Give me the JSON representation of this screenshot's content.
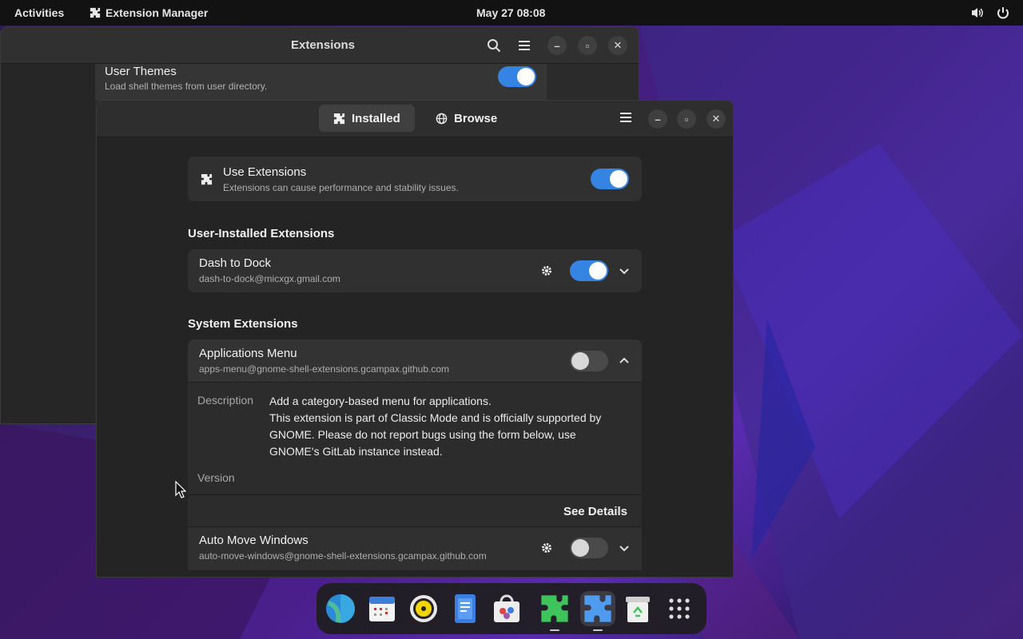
{
  "topbar": {
    "activities": "Activities",
    "app_menu": "Extension Manager",
    "clock": "May 27  08:08"
  },
  "back_window": {
    "title": "Extensions",
    "row": {
      "title": "User Themes",
      "subtitle": "Load shell themes from user directory.",
      "enabled": true
    }
  },
  "front_window": {
    "tabs": [
      {
        "label": "Installed",
        "icon": "puzzle-icon",
        "active": true
      },
      {
        "label": "Browse",
        "icon": "globe-icon",
        "active": false
      }
    ],
    "use_extensions": {
      "title": "Use Extensions",
      "subtitle": "Extensions can cause performance and stability issues.",
      "enabled": true
    },
    "user_section_title": "User-Installed Extensions",
    "user_extensions": [
      {
        "title": "Dash to Dock",
        "uuid": "dash-to-dock@micxgx.gmail.com",
        "enabled": true,
        "has_settings": true
      }
    ],
    "system_section_title": "System Extensions",
    "system_extensions": [
      {
        "title": "Applications Menu",
        "uuid": "apps-menu@gnome-shell-extensions.gcampax.github.com",
        "enabled": false,
        "expanded": true,
        "description_label": "Description",
        "description_lines": [
          "Add a category-based menu for applications.",
          "This extension is part of Classic Mode and is officially supported by",
          "GNOME. Please do not report bugs using the form below, use",
          "GNOME's GitLab instance instead."
        ],
        "version_label": "Version",
        "see_details": "See Details"
      },
      {
        "title": "Auto Move Windows",
        "uuid": "auto-move-windows@gnome-shell-extensions.gcampax.github.com",
        "enabled": false,
        "has_settings": true
      }
    ]
  },
  "dock": {
    "items": [
      "web-browser-icon",
      "calendar-icon",
      "rhythmbox-icon",
      "text-editor-icon",
      "software-store-icon",
      "extensions-icon",
      "extension-manager-icon",
      "trash-icon",
      "app-grid-icon"
    ]
  },
  "colors": {
    "accent": "#3584e4",
    "window_bg": "#242424",
    "card_bg": "#303030"
  }
}
